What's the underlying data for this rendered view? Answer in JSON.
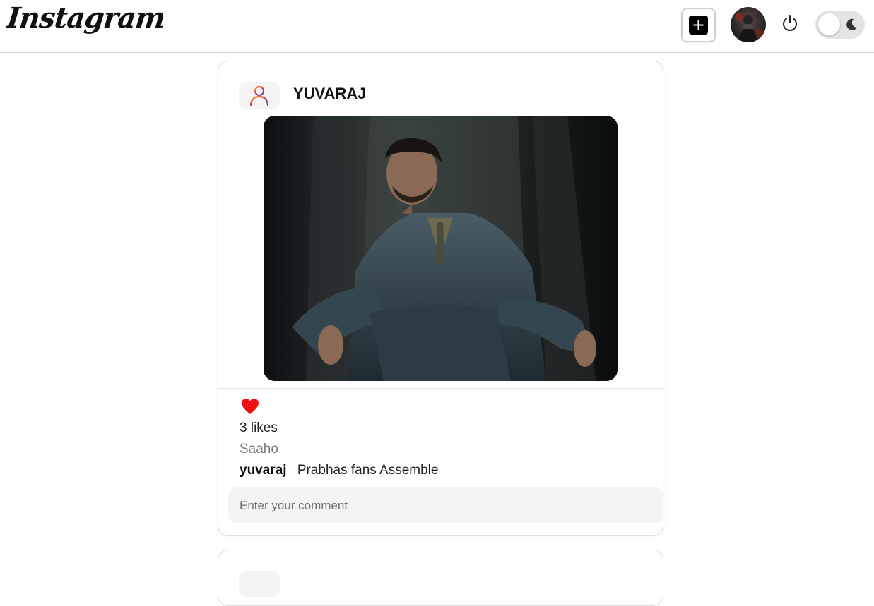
{
  "header": {
    "logo_text": "Instagram",
    "new_post_icon": "plus-square-icon",
    "profile_avatar_icon": "profile-avatar",
    "logout_icon": "power-icon",
    "theme_toggle_icon": "moon-icon"
  },
  "post": {
    "username": "YUVARAJ",
    "avatar_icon": "user-gradient-icon",
    "image_icon": "post-photo",
    "like_icon": "heart-icon",
    "like_color": "#ee1111",
    "likes_text": "3 likes",
    "caption": "Saaho",
    "comments": [
      {
        "user": "yuvaraj",
        "text": "Prabhas fans Assemble"
      }
    ],
    "comment_placeholder": "Enter your comment"
  }
}
